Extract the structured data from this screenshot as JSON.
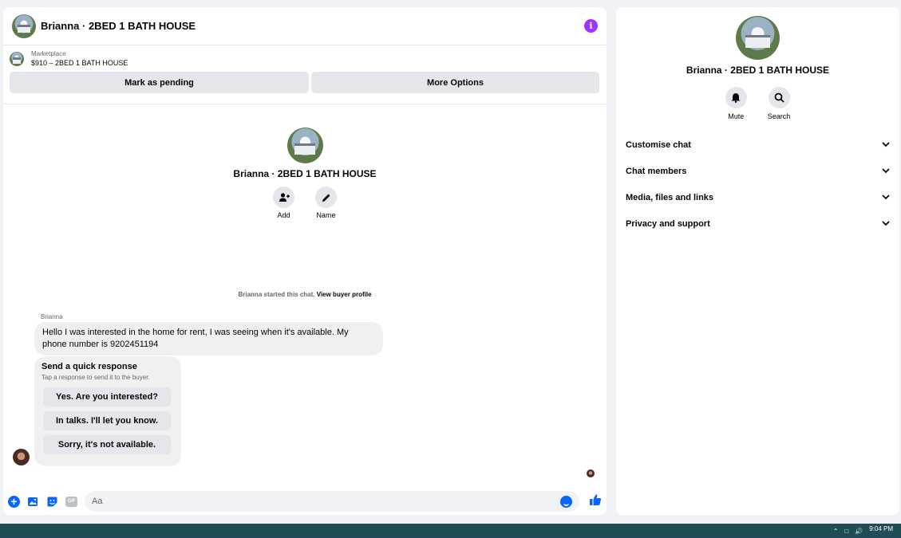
{
  "chat": {
    "title": "Brianna · 2BED 1 BATH HOUSE",
    "marketplace_label": "Marketplace",
    "listing": "$910 – 2BED 1 BATH HOUSE",
    "mark_pending": "Mark as pending",
    "more_options": "More Options"
  },
  "intro": {
    "name": "Brianna · 2BED 1 BATH HOUSE",
    "add_label": "Add",
    "name_label": "Name",
    "started_text": "Brianna started this chat.",
    "view_profile": "View buyer profile"
  },
  "messages": {
    "sender": "Brianna",
    "text": "Hello I was interested in the home for rent, I was seeing when it's available. My phone number is 9202451194"
  },
  "quick_response": {
    "title": "Send a quick response",
    "subtitle": "Tap a response to send it to the buyer.",
    "options": [
      "Yes. Are you interested?",
      "In talks. I'll let you know.",
      "Sorry, it's not available."
    ]
  },
  "composer": {
    "placeholder": "Aa",
    "gif_label": "GIF"
  },
  "info": {
    "name": "Brianna · 2BED 1 BATH HOUSE",
    "mute_label": "Mute",
    "search_label": "Search",
    "sections": [
      "Customise chat",
      "Chat members",
      "Media, files and links",
      "Privacy and support"
    ]
  },
  "taskbar": {
    "time": "9:04 PM"
  },
  "colors": {
    "accent": "#0866ff",
    "info_purple": "#a033ff",
    "taskbar": "#1e4d55"
  }
}
